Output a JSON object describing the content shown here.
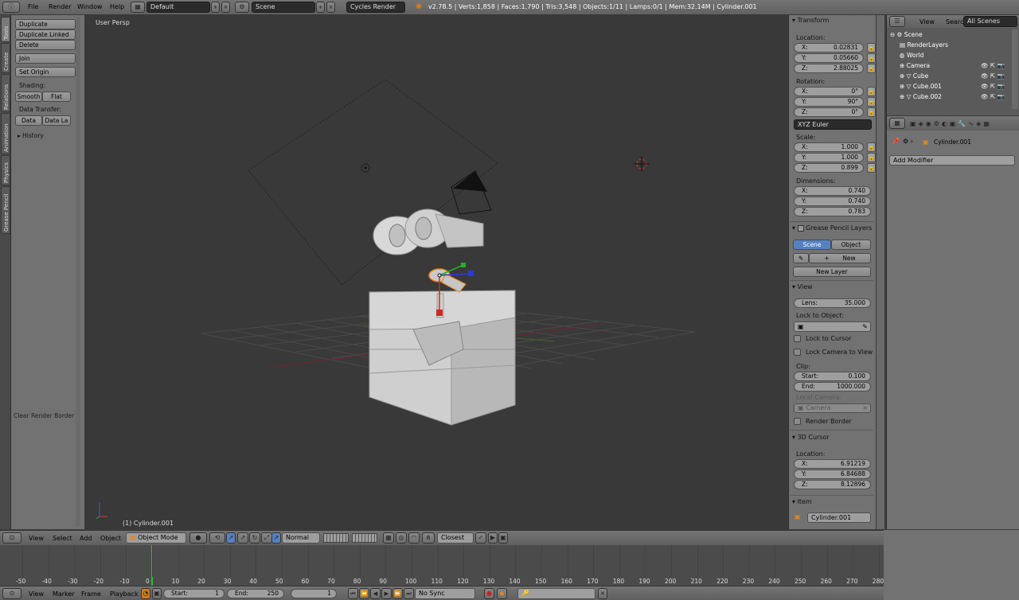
{
  "topbar": {
    "info_icon": "info-icon",
    "menus": [
      "File",
      "Render",
      "Window",
      "Help"
    ],
    "layout": "Default",
    "scene": "Scene",
    "engine": "Cycles Render",
    "stats": "v2.78.5 | Verts:1,858 | Faces:1,790 | Tris:3,548 | Objects:1/11 | Lamps:0/1 | Mem:32.14M | Cylinder.001"
  },
  "left_tabs": [
    "Tools",
    "Create",
    "Relations",
    "Animation",
    "Physics",
    "Grease Pencil"
  ],
  "tools": {
    "duplicate": "Duplicate",
    "duplicate_linked": "Duplicate Linked",
    "delete": "Delete",
    "join": "Join",
    "set_origin": "Set Origin",
    "shading_label": "Shading:",
    "smooth": "Smooth",
    "flat": "Flat",
    "data_transfer_label": "Data Transfer:",
    "data": "Data",
    "data_la": "Data La",
    "history": "History",
    "clear_render_border": "Clear Render Border"
  },
  "viewport": {
    "mode_label": "User Persp",
    "object_label": "(1) Cylinder.001"
  },
  "npanel": {
    "transform_title": "Transform",
    "location_label": "Location:",
    "location": [
      {
        "k": "X:",
        "v": "0.02831"
      },
      {
        "k": "Y:",
        "v": "0.05660"
      },
      {
        "k": "Z:",
        "v": "2.88025"
      }
    ],
    "rotation_label": "Rotation:",
    "rotation": [
      {
        "k": "X:",
        "v": "0°"
      },
      {
        "k": "Y:",
        "v": "90°"
      },
      {
        "k": "Z:",
        "v": "0°"
      }
    ],
    "rotation_mode": "XYZ Euler",
    "scale_label": "Scale:",
    "scale": [
      {
        "k": "X:",
        "v": "1.000"
      },
      {
        "k": "Y:",
        "v": "1.000"
      },
      {
        "k": "Z:",
        "v": "0.899"
      }
    ],
    "dimensions_label": "Dimensions:",
    "dimensions": [
      {
        "k": "X:",
        "v": "0.740"
      },
      {
        "k": "Y:",
        "v": "0.740"
      },
      {
        "k": "Z:",
        "v": "0.783"
      }
    ],
    "grease_title": "Grease Pencil Layers",
    "scene_tab": "Scene",
    "object_tab": "Object",
    "new": "New",
    "new_layer": "New Layer",
    "view_title": "View",
    "lens_k": "Lens:",
    "lens_v": "35.000",
    "lock_to_object": "Lock to Object:",
    "lock_to_cursor": "Lock to Cursor",
    "lock_camera": "Lock Camera to View",
    "clip_label": "Clip:",
    "clip_start_k": "Start:",
    "clip_start_v": "0.100",
    "clip_end_k": "End:",
    "clip_end_v": "1000.000",
    "local_camera": "Local Camera:",
    "camera": "Camera",
    "render_border": "Render Border",
    "cursor_title": "3D Cursor",
    "cursor_location_label": "Location:",
    "cursor": [
      {
        "k": "X:",
        "v": "6.91219"
      },
      {
        "k": "Y:",
        "v": "6.84688"
      },
      {
        "k": "Z:",
        "v": "8.12896"
      }
    ],
    "item_title": "Item",
    "item_name": "Cylinder.001"
  },
  "outliner": {
    "view": "View",
    "search": "Search",
    "all_scenes": "All Scenes",
    "rows": [
      "Scene",
      "RenderLayers",
      "World",
      "Camera",
      "Cube",
      "Cube.001",
      "Cube.002"
    ]
  },
  "properties": {
    "object_name": "Cylinder.001",
    "add_modifier": "Add Modifier"
  },
  "vp_header": {
    "menus": [
      "View",
      "Select",
      "Add",
      "Object"
    ],
    "mode": "Object Mode",
    "orientation": "Normal",
    "snap": "Closest"
  },
  "timeline": {
    "ticks": [
      "-50",
      "-40",
      "-30",
      "-20",
      "-10",
      "0",
      "10",
      "20",
      "30",
      "40",
      "50",
      "60",
      "70",
      "80",
      "90",
      "100",
      "110",
      "120",
      "130",
      "140",
      "150",
      "160",
      "170",
      "180",
      "190",
      "200",
      "210",
      "220",
      "230",
      "240",
      "250",
      "260",
      "270",
      "280"
    ],
    "menus": [
      "View",
      "Marker",
      "Frame",
      "Playback"
    ],
    "start_k": "Start:",
    "start_v": "1",
    "end_k": "End:",
    "end_v": "250",
    "current": "1",
    "sync": "No Sync"
  }
}
